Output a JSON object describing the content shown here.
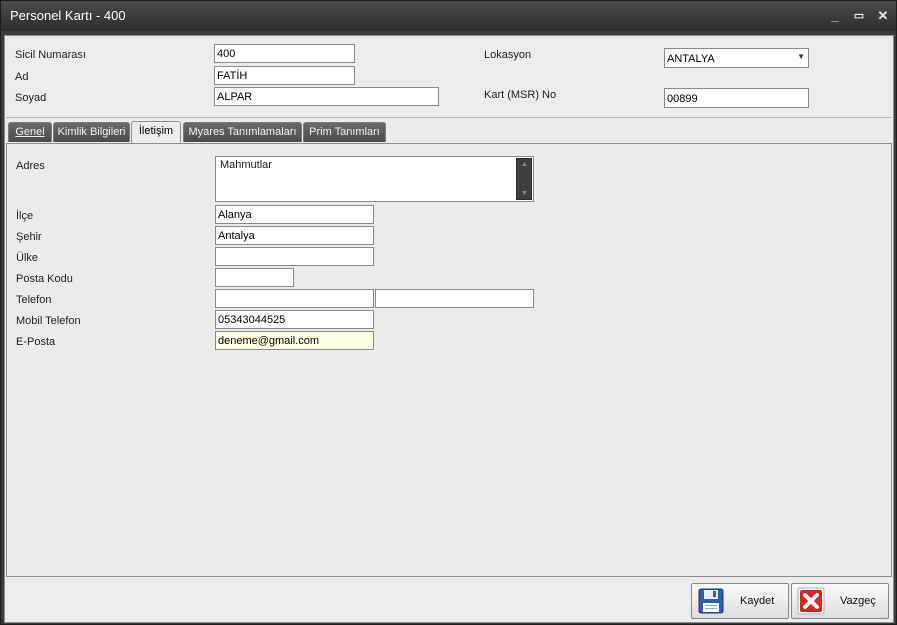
{
  "window": {
    "title": "Personel Kartı - 400",
    "controls": {
      "minimize": "_",
      "maximize": "▭",
      "close": "✕"
    }
  },
  "header": {
    "sicil_label": "Sicil Numarası",
    "sicil_value": "400",
    "ad_label": "Ad",
    "ad_value": "FATİH",
    "soyad_label": "Soyad",
    "soyad_value": "ALPAR",
    "lokasyon_label": "Lokasyon",
    "lokasyon_value": "ANTALYA",
    "kart_label": "Kart (MSR) No",
    "kart_value": "00899"
  },
  "tabs": [
    {
      "label": "Genel"
    },
    {
      "label": "Kimlik Bilgileri"
    },
    {
      "label": "İletişim"
    },
    {
      "label": "Myares Tanımlamaları"
    },
    {
      "label": "Prim Tanımları"
    }
  ],
  "active_tab": "İletişim",
  "iletisim": {
    "adres_label": "Adres",
    "adres_value": "Mahmutlar",
    "ilce_label": "İlçe",
    "ilce_value": "Alanya",
    "sehir_label": "Şehir",
    "sehir_value": "Antalya",
    "ulke_label": "Ülke",
    "ulke_value": "",
    "posta_label": "Posta Kodu",
    "posta_value": "",
    "telefon_label": "Telefon",
    "telefon_value1": "",
    "telefon_value2": "",
    "mobil_label": "Mobil Telefon",
    "mobil_value": "05343044525",
    "eposta_label": "E-Posta",
    "eposta_value": "deneme@gmail.com"
  },
  "buttons": {
    "save_label": "Kaydet",
    "save_icon": "floppy-disk-icon",
    "cancel_label": "Vazgeç",
    "cancel_icon": "red-x-icon"
  },
  "colors": {
    "titlebar": "#3a3a3a",
    "panel": "#ebebeb",
    "focused_field": "#ffffe6",
    "cancel_red": "#d9261c",
    "save_blue": "#2d5fae"
  }
}
